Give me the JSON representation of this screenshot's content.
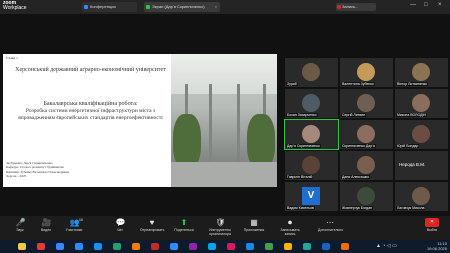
{
  "app": {
    "brand": "zoom",
    "brand_sub": "Workplace"
  },
  "tabs": [
    {
      "label": "Конференция",
      "color": "#2d8cff"
    },
    {
      "label": "Экран (Дар’я Скрипниченко)",
      "color": "#27c93f"
    }
  ],
  "recording": {
    "label": "Запись..."
  },
  "slide": {
    "number": "Слайд 1",
    "university": "Херсонський державний аграрно-економічний університет",
    "work_type": "Бакалаврська кваліфікаційна робота:",
    "topic": "Розробка системи енергетичної інфраструктури міста з впровадженням європейських стандартів енергоефективності",
    "footer": [
      "Здобувачка: Дар’я Скрипниченко",
      "Кафедра: Сталого розвитку і будівництва",
      "Керівник: Зубенко Валентина Олександрівна",
      "Херсон – 2025"
    ]
  },
  "participants": [
    {
      "name": "Зураб",
      "type": "video",
      "color": "#6b5a48"
    },
    {
      "name": "Валентина Зубенко",
      "type": "video",
      "color": "#c49a5a"
    },
    {
      "name": "Віктор Литвиненко",
      "type": "video",
      "color": "#8b7355"
    },
    {
      "name": "Бохан Захарченко",
      "type": "video",
      "color": "#4f5c66"
    },
    {
      "name": "Сергій Литвин",
      "type": "video",
      "color": "#6f5f52"
    },
    {
      "name": "Микола ВОЛОДІН",
      "type": "video",
      "color": "#8a6d5b"
    },
    {
      "name": "Дар’я Скрипниченко",
      "type": "video",
      "color": "#a38a7a",
      "active": true
    },
    {
      "name": "Скрипниченко Дар’я",
      "type": "video",
      "color": "#8d6e5e"
    },
    {
      "name": "Юрій Бондар",
      "type": "video",
      "color": "#6a4e44"
    },
    {
      "name": "Гаврілін Віталій",
      "type": "video",
      "color": "#5a4238"
    },
    {
      "name": "Даня Алексашко",
      "type": "video",
      "color": "#7a5e4e"
    },
    {
      "name": "Нерода В.М.",
      "type": "plain"
    },
    {
      "name": "Вадим Кисельов",
      "type": "letter",
      "letter": "V"
    },
    {
      "name": "Жовнерчук Богдан",
      "type": "video",
      "color": "#3e4a3a"
    },
    {
      "name": "Лаговчук Микола",
      "type": "video",
      "color": "#6e5a4a"
    }
  ],
  "controls": [
    {
      "label": "Звук",
      "icon": "🎤"
    },
    {
      "label": "Видео",
      "icon": "🎥"
    },
    {
      "label": "Участники",
      "icon": "👥",
      "count": "16"
    },
    {
      "label": "Чат",
      "icon": "💬"
    },
    {
      "label": "Отреагировать",
      "icon": "♥"
    },
    {
      "label": "Поделиться",
      "icon": "⬆"
    },
    {
      "label": "Инструменты организатора",
      "icon": "🛡"
    },
    {
      "label": "Приложения",
      "icon": "▦"
    },
    {
      "label": "Записывать запись",
      "icon": "⏺"
    },
    {
      "label": "Дополнительно",
      "icon": "⋯"
    },
    {
      "label": "Выйти",
      "icon": "✕"
    }
  ],
  "taskbar": {
    "time": "11:10",
    "date": "19.06.2025",
    "icon_colors": [
      "#f2c744",
      "#e53935",
      "#3a86ff",
      "#2d8cff",
      "#1f8ef1",
      "#22a06b",
      "#f57c00",
      "#c62828",
      "#2d8cff",
      "#8e24aa",
      "#00a4ef",
      "#d81b60",
      "#1e88e5",
      "#43a047",
      "#ffb300",
      "#26a69a",
      "#1565c0",
      "#ef6c00"
    ]
  }
}
